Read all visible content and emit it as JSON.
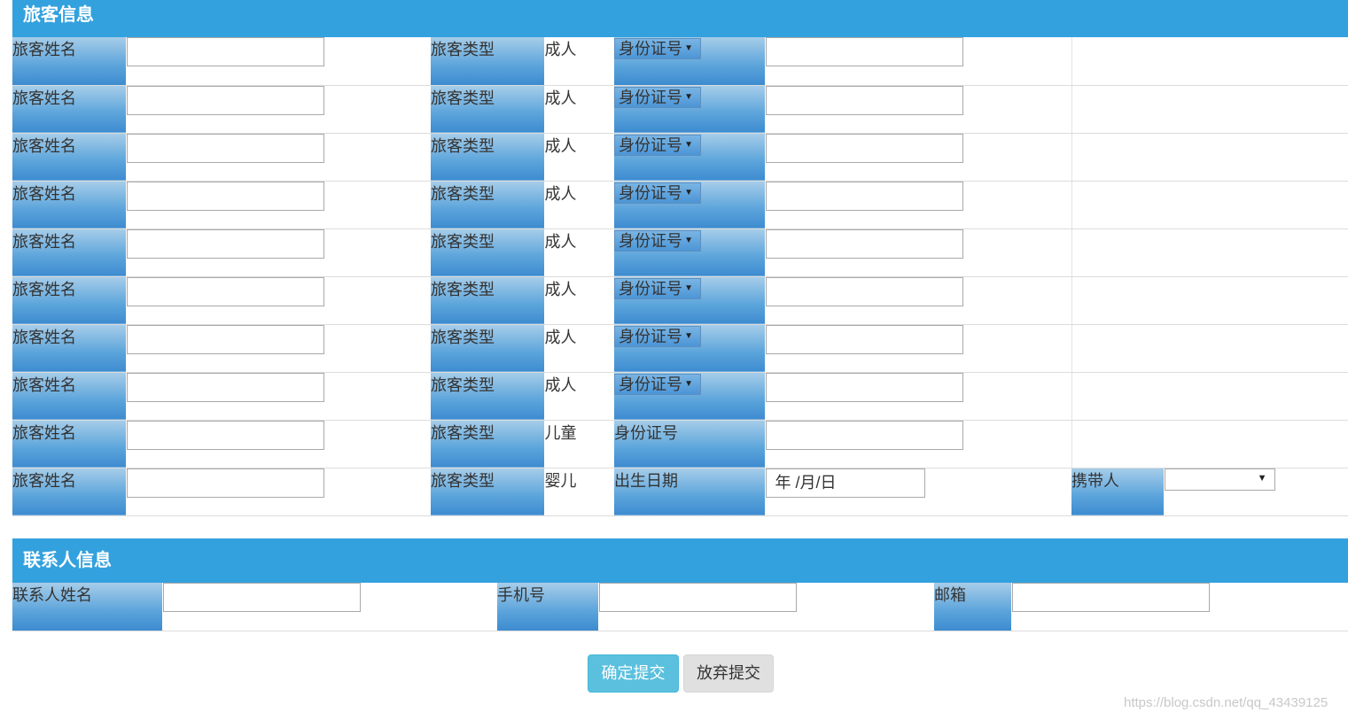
{
  "passenger_section": {
    "title": "旅客信息",
    "name_label": "旅客姓名",
    "type_label": "旅客类型",
    "adult_rows": [
      {
        "type_value": "成人",
        "id_type": "身份证号"
      },
      {
        "type_value": "成人",
        "id_type": "身份证号"
      },
      {
        "type_value": "成人",
        "id_type": "身份证号"
      },
      {
        "type_value": "成人",
        "id_type": "身份证号"
      },
      {
        "type_value": "成人",
        "id_type": "身份证号"
      },
      {
        "type_value": "成人",
        "id_type": "身份证号"
      },
      {
        "type_value": "成人",
        "id_type": "身份证号"
      },
      {
        "type_value": "成人",
        "id_type": "身份证号"
      }
    ],
    "child_row": {
      "type_value": "儿童",
      "id_label": "身份证号"
    },
    "infant_row": {
      "type_value": "婴儿",
      "birth_label": "出生日期",
      "birth_placeholder": "年 /月/日",
      "carrier_label": "携带人",
      "carrier_value": ""
    }
  },
  "contact_section": {
    "title": "联系人信息",
    "name_label": "联系人姓名",
    "phone_label": "手机号",
    "email_label": "邮箱"
  },
  "buttons": {
    "confirm": "确定提交",
    "cancel": "放弃提交"
  },
  "watermark": "https://blog.csdn.net/qq_43439125",
  "colors": {
    "header_blue": "#33a1de",
    "label_gradient_top": "#a7cde9",
    "label_gradient_bottom": "#3d8bd0",
    "confirm_button": "#5bc0de",
    "cancel_button": "#e0e0e0"
  }
}
